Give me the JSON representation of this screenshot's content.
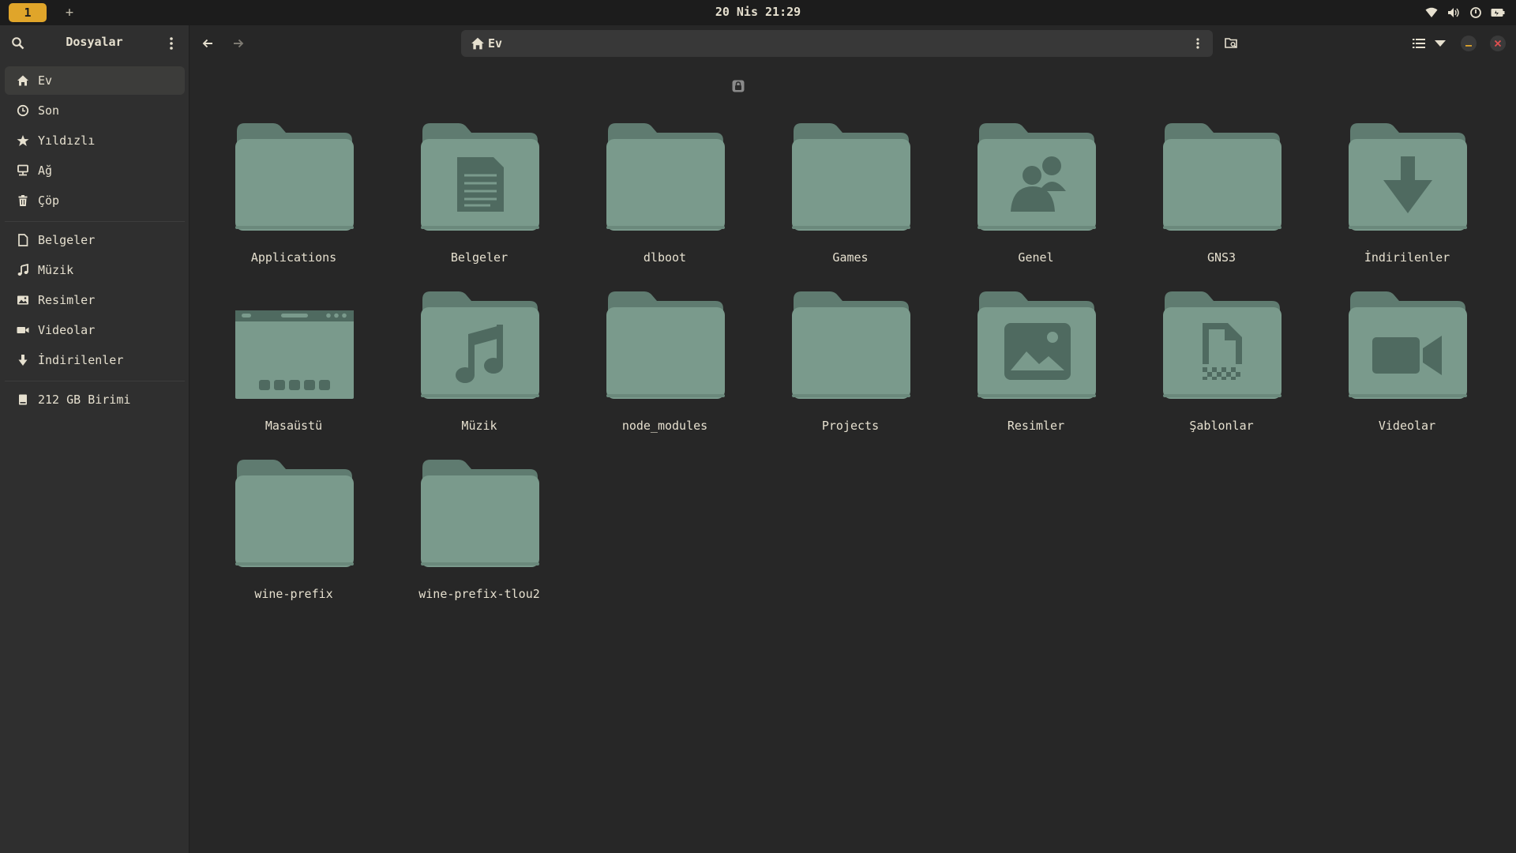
{
  "topbar": {
    "workspace": "1",
    "add": "+",
    "clock": "20 Nis 21:29",
    "tray_icons": [
      "wifi-icon",
      "volume-icon",
      "power-icon",
      "battery-icon"
    ]
  },
  "sidebar": {
    "title": "Dosyalar",
    "places": [
      {
        "label": "Ev",
        "icon": "home-icon",
        "active": true
      },
      {
        "label": "Son",
        "icon": "clock-icon"
      },
      {
        "label": "Yıldızlı",
        "icon": "star-icon"
      },
      {
        "label": "Ağ",
        "icon": "network-icon"
      },
      {
        "label": "Çöp",
        "icon": "trash-icon"
      }
    ],
    "bookmarks": [
      {
        "label": "Belgeler",
        "icon": "document-icon"
      },
      {
        "label": "Müzik",
        "icon": "music-icon"
      },
      {
        "label": "Resimler",
        "icon": "picture-icon"
      },
      {
        "label": "Videolar",
        "icon": "video-icon"
      },
      {
        "label": "İndirilenler",
        "icon": "download-icon"
      }
    ],
    "devices": [
      {
        "label": "212 GB Birimi",
        "icon": "drive-icon"
      }
    ]
  },
  "header": {
    "path": "Ev"
  },
  "files": [
    {
      "name": "Applications",
      "emblem": "none"
    },
    {
      "name": "Belgeler",
      "emblem": "document"
    },
    {
      "name": "dlboot",
      "emblem": "none",
      "locked": true
    },
    {
      "name": "Games",
      "emblem": "none"
    },
    {
      "name": "Genel",
      "emblem": "people"
    },
    {
      "name": "GNS3",
      "emblem": "none"
    },
    {
      "name": "İndirilenler",
      "emblem": "download"
    },
    {
      "name": "Masaüstü",
      "emblem": "desktop"
    },
    {
      "name": "Müzik",
      "emblem": "music"
    },
    {
      "name": "node_modules",
      "emblem": "none"
    },
    {
      "name": "Projects",
      "emblem": "none"
    },
    {
      "name": "Resimler",
      "emblem": "picture"
    },
    {
      "name": "Şablonlar",
      "emblem": "template"
    },
    {
      "name": "Videolar",
      "emblem": "video"
    },
    {
      "name": "wine-prefix",
      "emblem": "none"
    },
    {
      "name": "wine-prefix-tlou2",
      "emblem": "none"
    }
  ],
  "colors": {
    "accent": "#e0a52a",
    "folder_front": "#7a9a8c",
    "folder_back": "#5f7b70",
    "folder_emblem": "#4f6a60",
    "close": "#e05050"
  }
}
